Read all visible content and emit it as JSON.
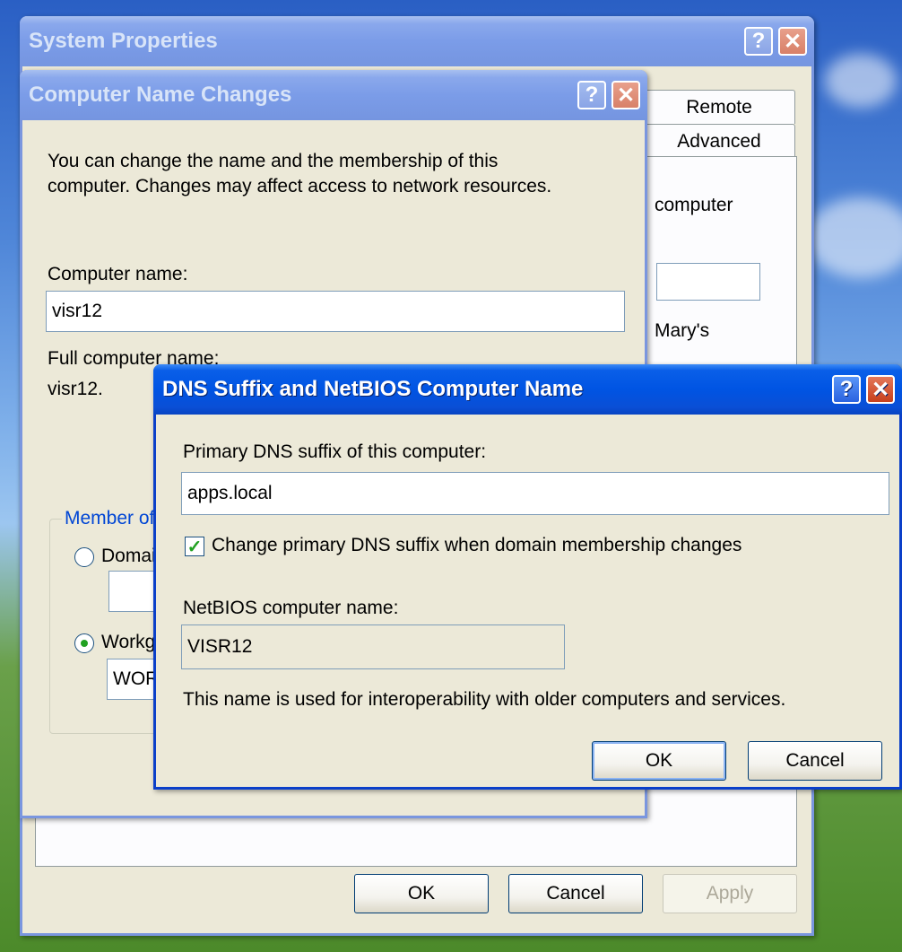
{
  "system_properties": {
    "title": "System Properties",
    "tabs": {
      "remote": "Remote",
      "advanced": "Advanced"
    },
    "fragments": {
      "computer": "computer",
      "marys": "Mary's"
    },
    "ok": "OK",
    "cancel": "Cancel",
    "apply": "Apply"
  },
  "computer_name_changes": {
    "title": "Computer Name Changes",
    "description_line1": "You can change the name and the membership of this",
    "description_line2": "computer. Changes may affect access to network resources.",
    "computer_name_label": "Computer name:",
    "computer_name_value": "visr12",
    "full_name_label": "Full computer name:",
    "full_name_value": "visr12.",
    "member_of_label": "Member of",
    "domain_label": "Domain:",
    "workgroup_label": "Workgroup:",
    "workgroup_value": "WORKGROUP"
  },
  "dns_dialog": {
    "title": "DNS Suffix and NetBIOS Computer Name",
    "primary_label": "Primary DNS suffix of this computer:",
    "primary_value": "apps.local",
    "change_checkbox_label": "Change primary DNS suffix when domain membership changes",
    "change_checked": true,
    "netbios_label": "NetBIOS computer name:",
    "netbios_value": "VISR12",
    "info_text": "This name is used for interoperability with older computers and services.",
    "ok": "OK",
    "cancel": "Cancel"
  },
  "icons": {
    "help": "?",
    "close": "✕",
    "check": "✓"
  },
  "colors": {
    "title_active": "#0054e3",
    "title_inactive": "#7b9ce8",
    "dialog_bg": "#ece9d8",
    "close_btn": "#c8401c"
  }
}
